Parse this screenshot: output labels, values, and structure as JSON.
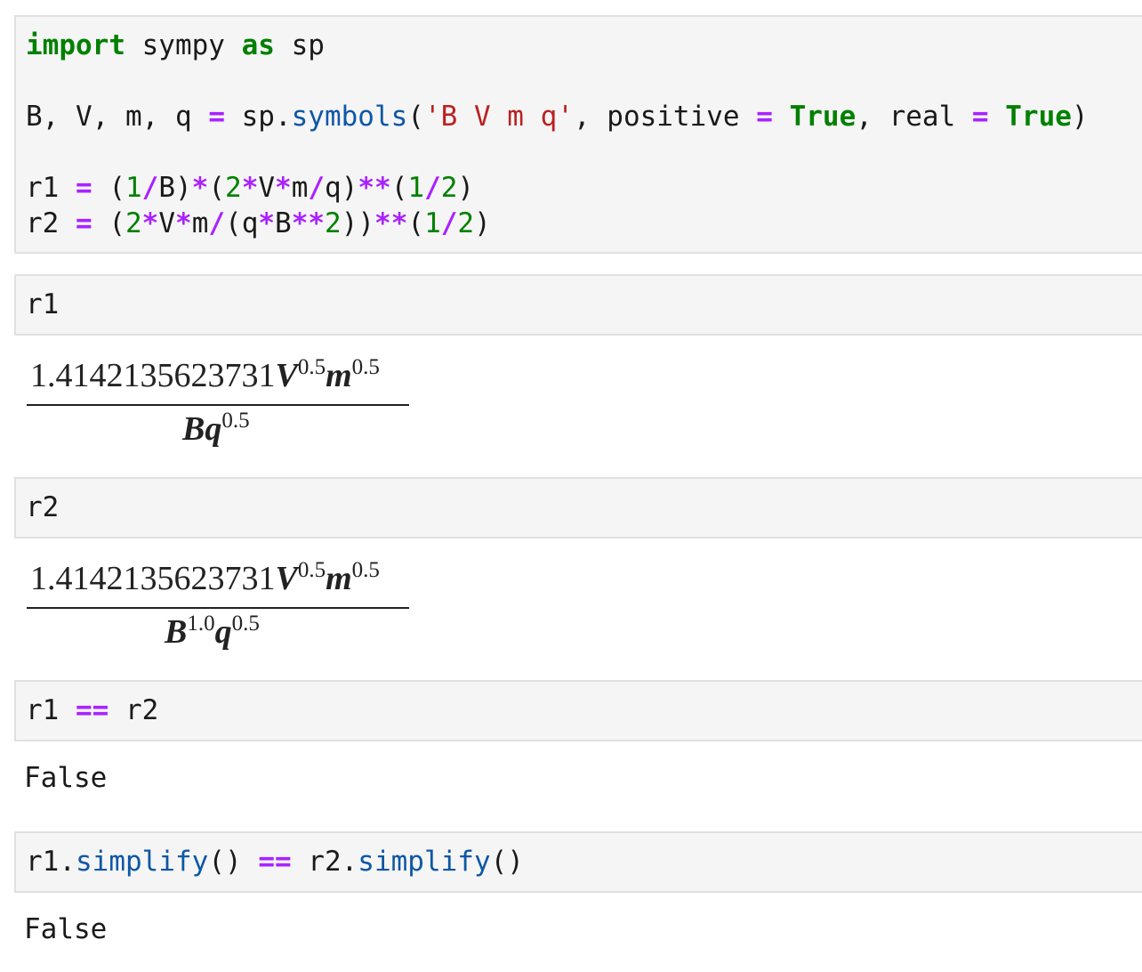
{
  "cells": {
    "c1": {
      "line1": {
        "kw1": "import",
        "t1": " sympy ",
        "kw2": "as",
        "t2": " sp"
      },
      "line2": {
        "t1": "B, V, m, q ",
        "op1": "=",
        "t2": " sp.",
        "fn": "symbols",
        "t3": "(",
        "str": "'B V m q'",
        "t4": ", positive ",
        "op2": "=",
        "t5": " ",
        "kw1": "True",
        "t6": ", real ",
        "op3": "=",
        "t7": " ",
        "kw2": "True",
        "t8": ")"
      },
      "line3": "r1 = (1/B)*(2*V*m/q)**(1/2)",
      "line4": "r2 = (2*V*m/(q*B**2))**(1/2)"
    },
    "c2": {
      "code": "r1"
    },
    "c3": {
      "code": "r2"
    },
    "c4": {
      "left": "r1 ",
      "op": "==",
      "right": " r2"
    },
    "c5": {
      "t1": "r1.",
      "fn1": "simplify",
      "t2": "() ",
      "op": "==",
      "t3": " r2.",
      "fn2": "simplify",
      "t4": "()"
    }
  },
  "outputs": {
    "o2": {
      "coef": "1.4142135623731",
      "v": "V",
      "v_exp": "0.5",
      "m": "m",
      "m_exp": "0.5",
      "den_b": "B",
      "den_q": "q",
      "den_q_exp": "0.5"
    },
    "o3": {
      "coef": "1.4142135623731",
      "v": "V",
      "v_exp": "0.5",
      "m": "m",
      "m_exp": "0.5",
      "den_b": "B",
      "den_b_exp": "1.0",
      "den_q": "q",
      "den_q_exp": "0.5"
    },
    "o4": "False",
    "o5": "False"
  },
  "colors": {
    "cell_background": "#f5f5f5",
    "cell_border": "#e0e0e0",
    "keyword": "#008000",
    "operator": "#aa22ff",
    "number": "#008000",
    "string": "#ba2121",
    "function": "#0e57a5",
    "text": "#1a1a1a"
  }
}
